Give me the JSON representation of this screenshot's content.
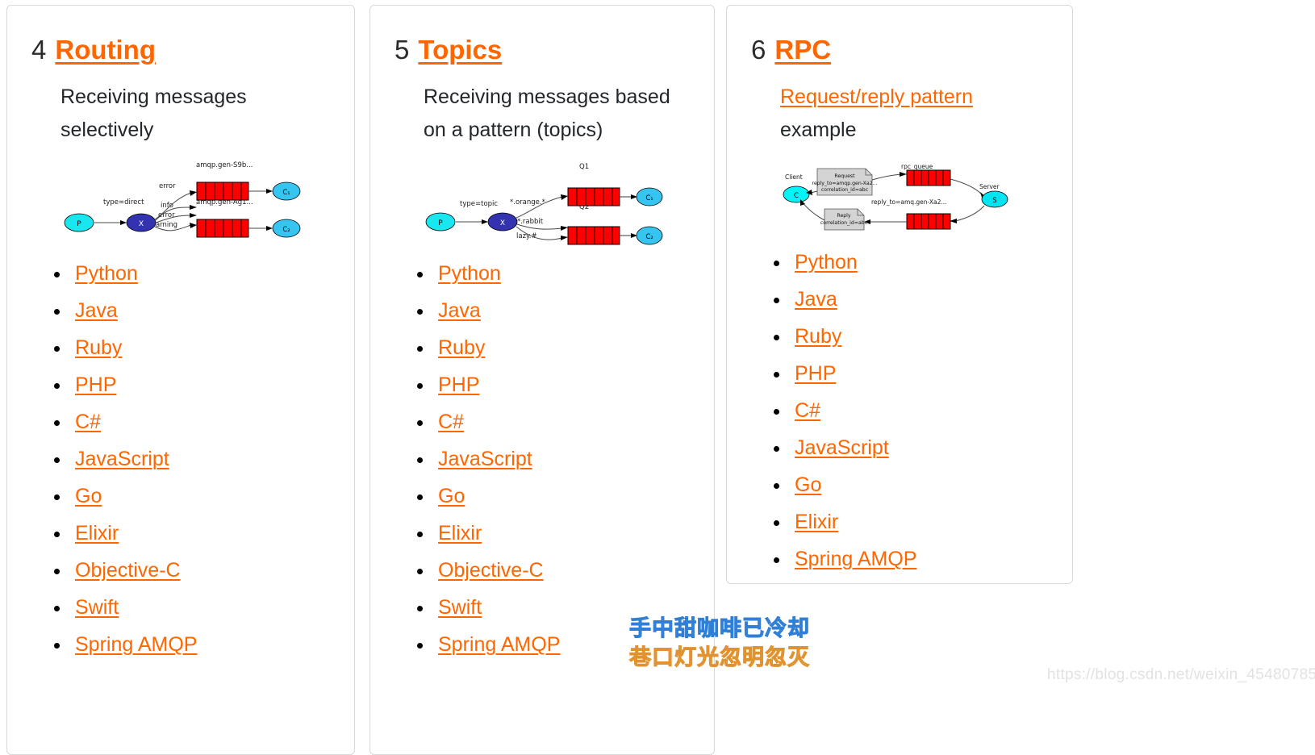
{
  "page": {
    "background": "#ffffff",
    "accent_color": "#ff6600",
    "text_color": "#22272b"
  },
  "cards": [
    {
      "number": "4",
      "title": "Routing",
      "subtitle": "Receiving messages selectively",
      "subtitle_is_link": false,
      "diagram": {
        "type": "routing",
        "producer": "P",
        "exchange": "X",
        "exchange_type": "type=direct",
        "queues": [
          "amqp.gen-S9b...",
          "amqp.gen-Ag1..."
        ],
        "bindings_top": [
          "error"
        ],
        "bindings_bottom": [
          "info",
          "error",
          "warning"
        ],
        "consumers": [
          "C₁",
          "C₂"
        ]
      },
      "languages": [
        "Python",
        "Java",
        "Ruby",
        "PHP",
        "C#",
        "JavaScript",
        "Go",
        "Elixir",
        "Objective-C",
        "Swift",
        "Spring AMQP"
      ]
    },
    {
      "number": "5",
      "title": "Topics",
      "subtitle": "Receiving messages based on a pattern (topics)",
      "subtitle_is_link": false,
      "diagram": {
        "type": "topics",
        "producer": "P",
        "exchange": "X",
        "exchange_type": "type=topic",
        "queues": [
          "Q1",
          "Q2"
        ],
        "bindings_top": [
          "*.orange.*"
        ],
        "bindings_bottom": [
          "*.*.rabbit",
          "lazy.#"
        ],
        "consumers": [
          "C₁",
          "C₂"
        ]
      },
      "languages": [
        "Python",
        "Java",
        "Ruby",
        "PHP",
        "C#",
        "JavaScript",
        "Go",
        "Elixir",
        "Objective-C",
        "Swift",
        "Spring AMQP"
      ]
    },
    {
      "number": "6",
      "title": "RPC",
      "subtitle": "Request/reply pattern example",
      "subtitle_link_text": "Request/reply pattern",
      "subtitle_rest_text": "example",
      "subtitle_is_link": true,
      "diagram": {
        "type": "rpc",
        "client_label": "Client",
        "client_node": "C",
        "server_label": "Server",
        "server_node": "S",
        "request_box": [
          "Request",
          "reply_to=amqp.gen-Xa2...",
          "correlation_id=abc"
        ],
        "reply_box": [
          "Reply",
          "correlation_id=abc"
        ],
        "queue_top_label": "rpc_queue",
        "queue_bottom_label": "reply_to=amq.gen-Xa2..."
      },
      "languages": [
        "Python",
        "Java",
        "Ruby",
        "PHP",
        "C#",
        "JavaScript",
        "Go",
        "Elixir",
        "Spring AMQP"
      ]
    }
  ],
  "watermark": {
    "line1": "手中甜咖啡已冷却",
    "line2": "巷口灯光忽明忽灭",
    "line1_color": "#5fa8ee",
    "line2_color": "#f3b062",
    "url": "https://blog.csdn.net/weixin_45480785"
  }
}
